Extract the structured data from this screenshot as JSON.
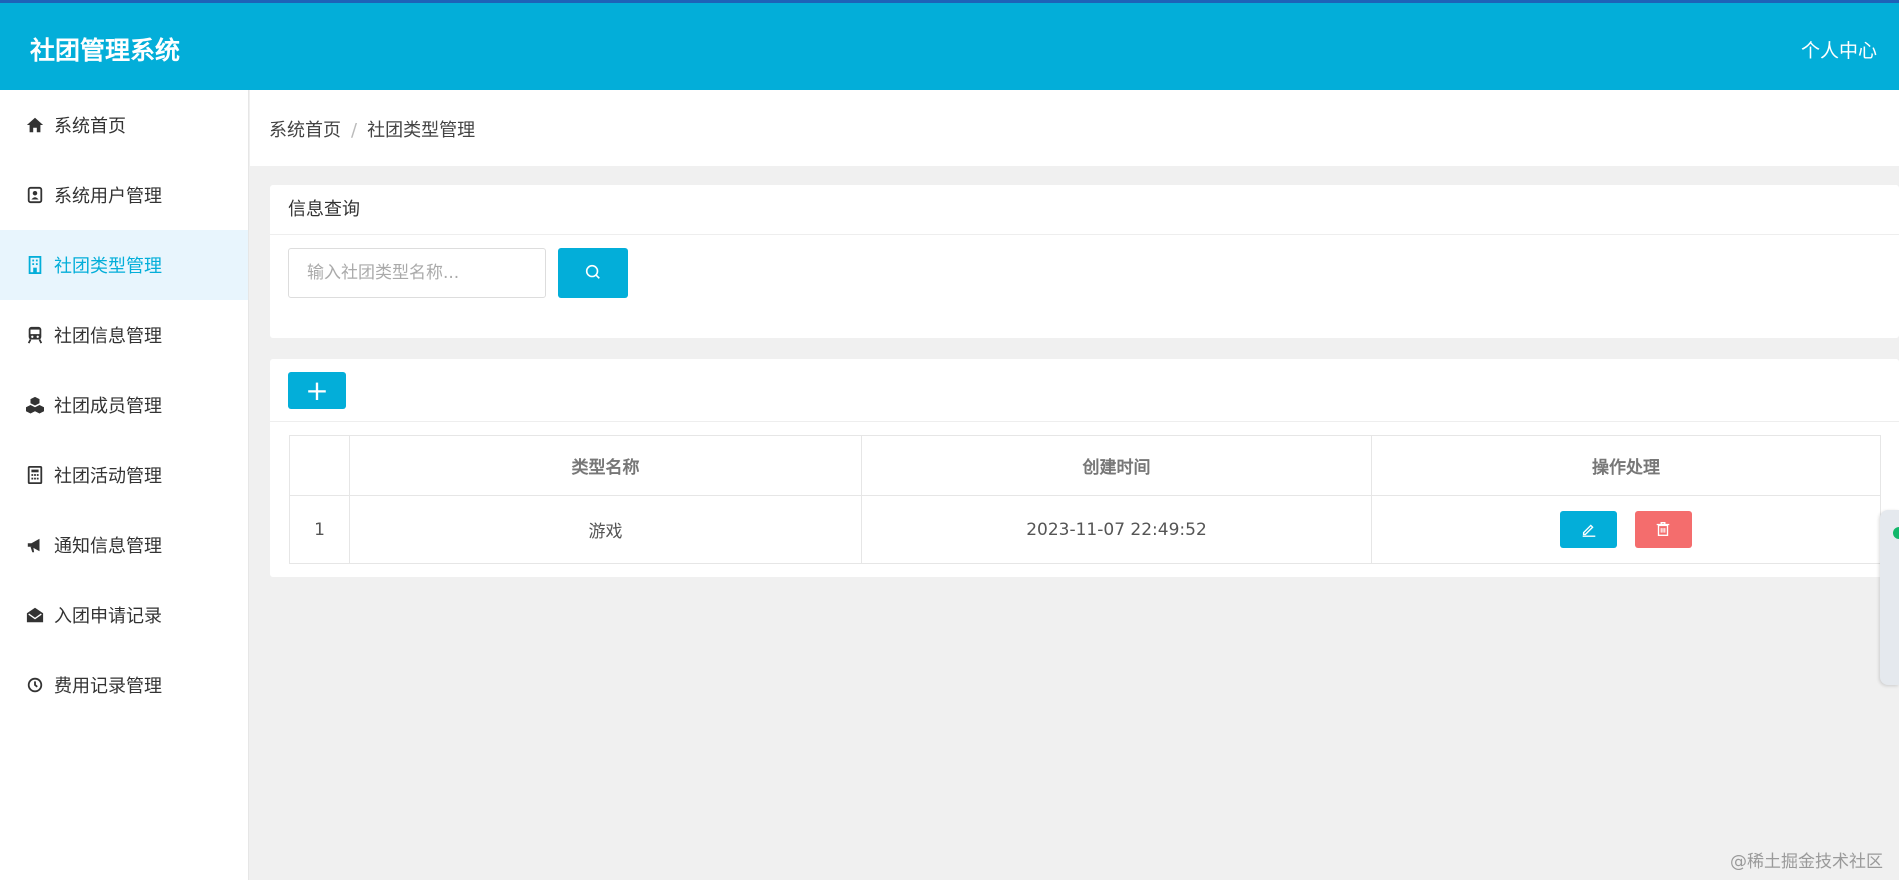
{
  "header": {
    "title": "社团管理系统",
    "user_center": "个人中心"
  },
  "sidebar": {
    "items": [
      {
        "label": "系统首页",
        "icon": "home-icon",
        "active": false
      },
      {
        "label": "系统用户管理",
        "icon": "user-card-icon",
        "active": false
      },
      {
        "label": "社团类型管理",
        "icon": "building-icon",
        "active": true
      },
      {
        "label": "社团信息管理",
        "icon": "train-icon",
        "active": false
      },
      {
        "label": "社团成员管理",
        "icon": "cubes-icon",
        "active": false
      },
      {
        "label": "社团活动管理",
        "icon": "calculator-icon",
        "active": false
      },
      {
        "label": "通知信息管理",
        "icon": "bullhorn-icon",
        "active": false
      },
      {
        "label": "入团申请记录",
        "icon": "envelope-open-icon",
        "active": false
      },
      {
        "label": "费用记录管理",
        "icon": "clock-icon",
        "active": false
      }
    ]
  },
  "breadcrumb": {
    "home": "系统首页",
    "separator": "/",
    "current": "社团类型管理"
  },
  "query": {
    "title": "信息查询",
    "placeholder": "输入社团类型名称...",
    "value": ""
  },
  "toolbar": {
    "add_label": "+"
  },
  "table": {
    "headers": [
      "",
      "类型名称",
      "创建时间",
      "操作处理"
    ],
    "rows": [
      {
        "index": "1",
        "name": "游戏",
        "created": "2023-11-07 22:49:52"
      }
    ]
  },
  "watermark": "@稀土掘金技术社区",
  "colors": {
    "primary": "#03aed9",
    "danger": "#f46d6d",
    "header_border": "#1e62b8",
    "active_bg": "#e8f5fd"
  }
}
